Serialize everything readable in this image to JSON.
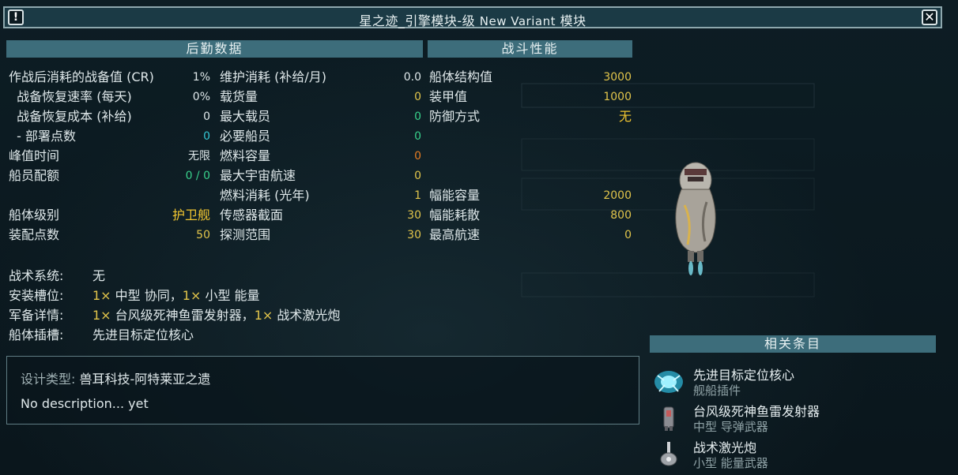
{
  "title": {
    "ship_name": "星之迹_引擎模块-级",
    "variant": "New Variant",
    "suffix": "模块"
  },
  "buttons": {
    "info": "!",
    "close": "✕"
  },
  "sections": {
    "logistics": "后勤数据",
    "combat": "战斗性能",
    "related": "相关条目"
  },
  "logistics_left": [
    {
      "label": "作战后消耗的战备值 (CR)",
      "value": "1%",
      "color": "white"
    },
    {
      "label": "  战备恢复速率 (每天)",
      "value": "0%",
      "color": "white"
    },
    {
      "label": "  战备恢复成本 (补给)",
      "value": "0",
      "color": "white"
    },
    {
      "label": "  - 部署点数",
      "value": "0",
      "color": "cyan"
    },
    {
      "label": "峰值时间",
      "value": "无限",
      "color": "white"
    },
    {
      "label": "船员配额",
      "value": "0 / 0",
      "color": "green"
    },
    {
      "label": "",
      "value": "",
      "color": "white"
    },
    {
      "label": "船体级别",
      "value": "护卫舰",
      "color": "yellowbig"
    },
    {
      "label": "装配点数",
      "value": "50",
      "color": "yellow"
    }
  ],
  "logistics_right": [
    {
      "label": "维护消耗 (补给/月)",
      "value": "0.0",
      "color": "white"
    },
    {
      "label": "载货量",
      "value": "0",
      "color": "yellow"
    },
    {
      "label": "最大载员",
      "value": "0",
      "color": "green"
    },
    {
      "label": "必要船员",
      "value": "0",
      "color": "green"
    },
    {
      "label": "燃料容量",
      "value": "0",
      "color": "orange"
    },
    {
      "label": "最大宇宙航速",
      "value": "0",
      "color": "yellow"
    },
    {
      "label": "燃料消耗 (光年)",
      "value": "1",
      "color": "yellow"
    },
    {
      "label": "传感器截面",
      "value": "30",
      "color": "yellow"
    },
    {
      "label": "探测范围",
      "value": "30",
      "color": "yellow"
    }
  ],
  "combat": [
    {
      "label": "船体结构值",
      "value": "3000",
      "color": "yellow"
    },
    {
      "label": "装甲值",
      "value": "1000",
      "color": "yellow"
    },
    {
      "label": "防御方式",
      "value": "无",
      "color": "yellowbig"
    },
    {
      "label": "",
      "value": "",
      "color": "white"
    },
    {
      "label": "",
      "value": "",
      "color": "white"
    },
    {
      "label": "",
      "value": "",
      "color": "white"
    },
    {
      "label": "幅能容量",
      "value": "2000",
      "color": "yellow"
    },
    {
      "label": "幅能耗散",
      "value": "800",
      "color": "yellow"
    },
    {
      "label": "最高航速",
      "value": "0",
      "color": "yellow"
    }
  ],
  "info": {
    "tactical_label": "战术系统:",
    "tactical_value": "无",
    "mounts_label": "安装槽位:",
    "mounts_q1": "1×",
    "mounts_v1": " 中型 协同，",
    "mounts_q2": "1×",
    "mounts_v2": " 小型 能量",
    "armament_label": "军备详情:",
    "armament_q1": "1×",
    "armament_v1": " 台风级死神鱼雷发射器，",
    "armament_q2": "1×",
    "armament_v2": " 战术激光炮",
    "hullmods_label": "船体插槽:",
    "hullmods_value": "先进目标定位核心"
  },
  "description": {
    "type_label": "设计类型:",
    "type_value": "兽耳科技-阿特莱亚之遗",
    "text": "No description... yet"
  },
  "related": [
    {
      "name": "先进目标定位核心",
      "category": "舰船插件",
      "icon": "hullmod-icon"
    },
    {
      "name": "台风级死神鱼雷发射器",
      "category": "中型 导弹武器",
      "icon": "torpedo-launcher-icon"
    },
    {
      "name": "战术激光炮",
      "category": "小型 能量武器",
      "icon": "laser-cannon-icon"
    }
  ],
  "colors": {
    "header_bg": "#3d6d7b",
    "value_yellow": "#e2c54b",
    "value_green": "#38d08b",
    "value_cyan": "#33c5d3",
    "value_orange": "#e57c22"
  }
}
